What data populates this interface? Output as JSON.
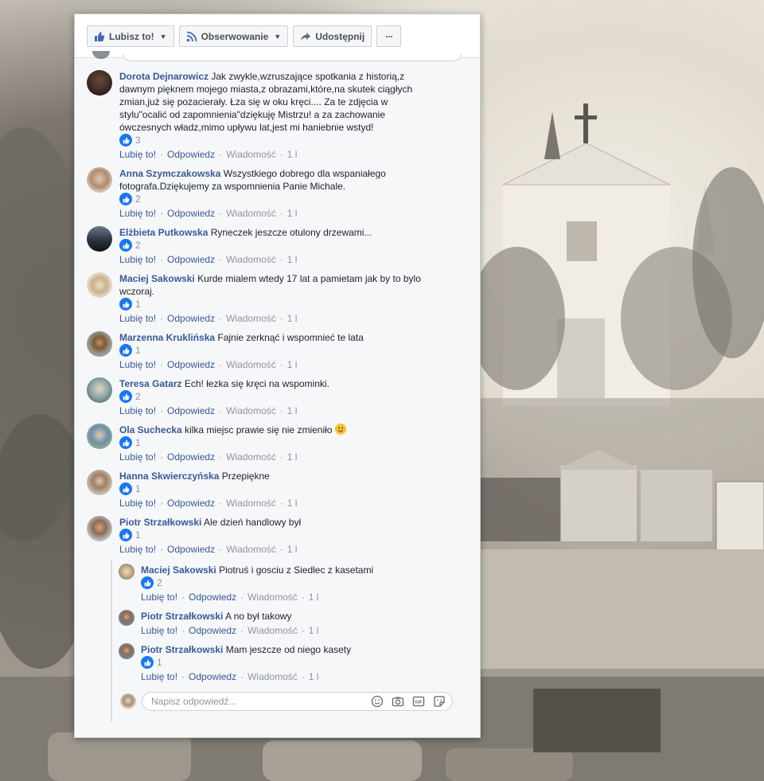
{
  "action_bar": {
    "like_label": "Lubisz to!",
    "follow_label": "Obserwowanie",
    "share_label": "Udostępnij",
    "more_label": "···"
  },
  "comments": [
    {
      "author": "Dorota Dejnarowicz",
      "text": "Jak zwykle,wzruszające spotkania z historią,z dawnym pięknem mojego miasta,z obrazami,które,na skutek ciągłych zmian,już się pozacierały. Łza się w oku kręci.... Za te zdjęcia w stylu\"ocalić od zapomnienia\"dziękuję Mistrzu! a za zachowanie ówczesnych władz,mimo upływu lat,jest mi haniebnie wstyd!",
      "likes": "3",
      "like_label": "Lubię to!",
      "reply_label": "Odpowiedz",
      "message_label": "Wiadomość",
      "time": "1 l"
    },
    {
      "author": "Anna Szymczakowska",
      "text": "Wszystkiego dobrego dla wspaniałego fotografa.Dziękujemy za wspomnienia Panie Michale.",
      "likes": "2",
      "like_label": "Lubię to!",
      "reply_label": "Odpowiedz",
      "message_label": "Wiadomość",
      "time": "1 l"
    },
    {
      "author": "Elżbieta Putkowska",
      "text": "Ryneczek jeszcze otulony drzewami...",
      "likes": "2",
      "like_label": "Lubię to!",
      "reply_label": "Odpowiedz",
      "message_label": "Wiadomość",
      "time": "1 l"
    },
    {
      "author": "Maciej Sakowski",
      "text": "Kurde mialem wtedy 17 lat a pamietam jak by to bylo wczoraj.",
      "likes": "1",
      "like_label": "Lubię to!",
      "reply_label": "Odpowiedz",
      "message_label": "Wiadomość",
      "time": "1 l"
    },
    {
      "author": "Marzenna Kruklińska",
      "text": "Fajnie zerknąć i wspomnieć te lata",
      "likes": "1",
      "like_label": "Lubię to!",
      "reply_label": "Odpowiedz",
      "message_label": "Wiadomość",
      "time": "1 l"
    },
    {
      "author": "Teresa Gatarz",
      "text": "Ech! łezka się kręci na wspominki.",
      "likes": "2",
      "like_label": "Lubię to!",
      "reply_label": "Odpowiedz",
      "message_label": "Wiadomość",
      "time": "1 l"
    },
    {
      "author": "Ola Suchecka",
      "text": "kilka miejsc prawie się nie zmieniło",
      "likes": "1",
      "like_label": "Lubię to!",
      "reply_label": "Odpowiedz",
      "message_label": "Wiadomość",
      "time": "1 l"
    },
    {
      "author": "Hanna Skwierczyńska",
      "text": "Przepiękne",
      "likes": "1",
      "like_label": "Lubię to!",
      "reply_label": "Odpowiedz",
      "message_label": "Wiadomość",
      "time": "1 l"
    },
    {
      "author": "Piotr Strzałkowski",
      "text": "Ale dzień handlowy był",
      "likes": "1",
      "like_label": "Lubię to!",
      "reply_label": "Odpowiedz",
      "message_label": "Wiadomość",
      "time": "1 l"
    }
  ],
  "replies": [
    {
      "author": "Maciej Sakowski",
      "text": "Piotruś i gosciu z Siedlec z kasetami",
      "likes": "2",
      "like_label": "Lubię to!",
      "reply_label": "Odpowiedz",
      "message_label": "Wiadomość",
      "time": "1 l"
    },
    {
      "author": "Piotr Strzałkowski",
      "text": "A no był takowy",
      "likes": "",
      "like_label": "Lubię to!",
      "reply_label": "Odpowiedz",
      "message_label": "Wiadomość",
      "time": "1 l"
    },
    {
      "author": "Piotr Strzałkowski",
      "text": "Mam jeszcze od niego kasety",
      "likes": "1",
      "like_label": "Lubię to!",
      "reply_label": "Odpowiedz",
      "message_label": "Wiadomość",
      "time": "1 l"
    }
  ],
  "reply_input": {
    "placeholder": "Napisz odpowiedź..."
  },
  "more": "...",
  "colors": {
    "link": "#385898",
    "like_blue": "#1877f2",
    "muted": "#90949c"
  }
}
